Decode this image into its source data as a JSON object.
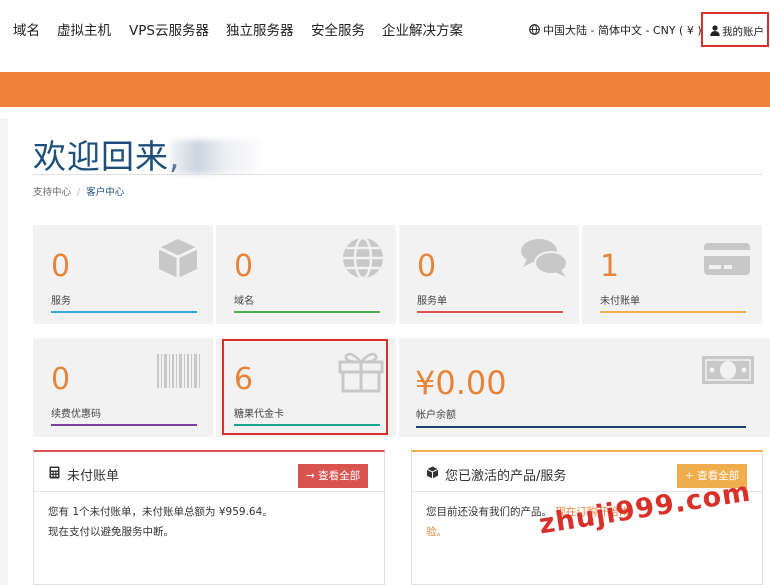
{
  "nav": {
    "items": [
      "域名",
      "虚拟主机",
      "VPS云服务器",
      "独立服务器",
      "安全服务",
      "企业解决方案"
    ],
    "locale": "中国大陆 - 简体中文 - CNY ( ¥ )",
    "account": "我的账户"
  },
  "header": {
    "welcome": "欢迎回来,",
    "breadcrumb": [
      "支持中心",
      "客户中心"
    ]
  },
  "tiles": [
    {
      "value": "0",
      "label": "服务",
      "color": "#3aa9d9",
      "icon": "cube-icon"
    },
    {
      "value": "0",
      "label": "域名",
      "color": "#4cae4c",
      "icon": "globe-icon"
    },
    {
      "value": "0",
      "label": "服务单",
      "color": "#d9534f",
      "icon": "chat-icon"
    },
    {
      "value": "1",
      "label": "未付账单",
      "color": "#f0ad4e",
      "icon": "credit-card-icon"
    },
    {
      "value": "0",
      "label": "续费优惠码",
      "color": "#7b3f9e",
      "icon": "barcode-icon"
    },
    {
      "value": "6",
      "label": "糖果代金卡",
      "color": "#19a58b",
      "icon": "gift-icon"
    }
  ],
  "balance": {
    "value": "¥0.00",
    "label": "帐户余额",
    "icon": "money-icon"
  },
  "panels": {
    "invoices": {
      "title": "未付账单",
      "button": "→ 查看全部",
      "line1": "您有 1个未付账单，未付账单总额为 ¥959.64。",
      "line2": "现在支付以避免服务中断。"
    },
    "products": {
      "title": "您已激活的产品/服务",
      "button": "+ 查看全部",
      "line1": "您目前还没有我们的产品。",
      "link1": "现在订购开始体",
      "link2": "验。"
    }
  },
  "watermark": "zhuji999.com"
}
